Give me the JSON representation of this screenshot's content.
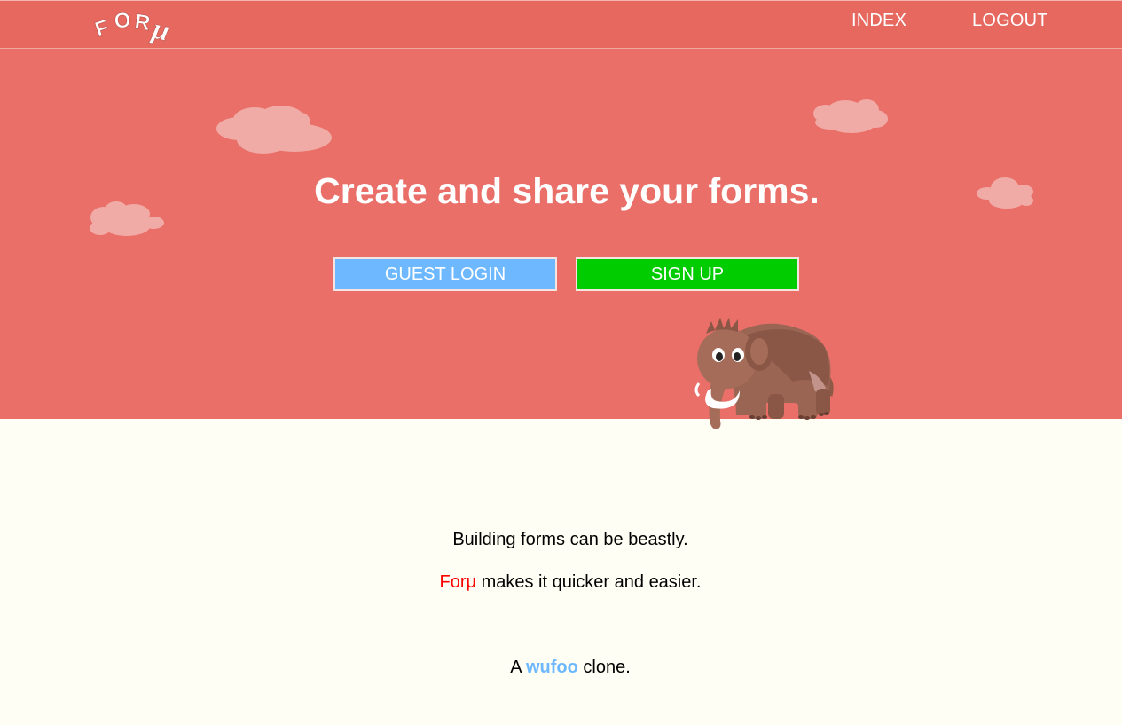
{
  "header": {
    "logo_text": "FORμ",
    "nav": {
      "index_label": "INDEX",
      "logout_label": "LOGOUT"
    }
  },
  "hero": {
    "headline": "Create and share your forms.",
    "guest_login_label": "GUEST LOGIN",
    "sign_up_label": "SIGN UP"
  },
  "content": {
    "line1": "Building forms can be beastly.",
    "line2_brand": "Forμ",
    "line2_rest": " makes it quicker and easier.",
    "line3_prefix": "A ",
    "line3_link": "wufoo",
    "line3_suffix": " clone."
  },
  "colors": {
    "topbar": "#e6685f",
    "hero": "#e96f68",
    "page_background": "#fffef4",
    "guest_button": "#6db8ff",
    "signup_button": "#00cc00",
    "brand_red": "#ff0000",
    "link_blue": "#6db8ff",
    "cloud": "#f1aba6"
  }
}
